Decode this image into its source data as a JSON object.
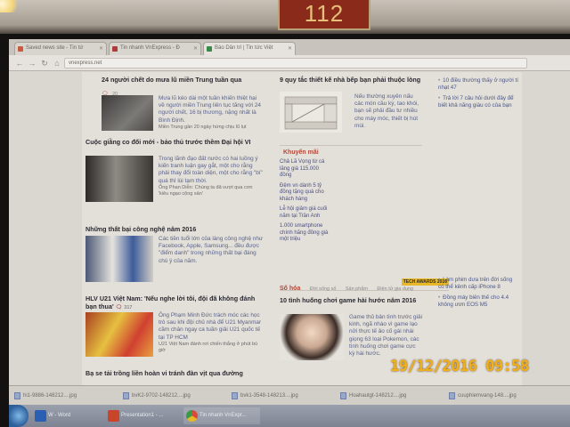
{
  "photo": {
    "wall_sign": "112",
    "timestamp": "19/12/2016 09:58"
  },
  "browser": {
    "tabs": [
      {
        "label": "Saved news site - Tin tứ",
        "active": false
      },
      {
        "label": "Tin nhanh VnExpress - Đ",
        "active": false
      },
      {
        "label": "Báo Dân trí | Tin tức Việt",
        "active": true
      }
    ],
    "url": "vnexpress.net"
  },
  "main_column": {
    "stories": [
      {
        "headline": "24 người chết do mưa lũ miền Trung tuần qua",
        "comments": "20",
        "summary": "Mưa lũ kéo dài một tuần khiến thiệt hại về người miền Trung liên tục tăng với 24 người chết, 16 bị thương, nặng nhất là Bình Định.",
        "related": "Miền Trung gần 20 ngày hứng chịu lũ lụt"
      },
      {
        "headline": "Cuộc giằng co đối mới - bảo thủ trước thềm Đại hội VI",
        "summary": "Trong lãnh đạo đất nước có hai luồng ý kiến tranh luận gay gắt, một cho rằng phải thay đổi toàn diện, một cho rằng \"bí\" quá thì lùi tạm thời.",
        "related": "Ông Phan Diễn: Chúng ta đã vượt qua cơn 'kiêu ngạo cộng sản'"
      },
      {
        "headline": "Những thất bại công nghệ năm 2016",
        "summary": "Các tiền tuổi lớn của làng công nghệ như Facebook, Apple, Samsung... đều được \"điểm danh\" trong những thất bại đáng chú ý của năm."
      },
      {
        "headline": "HLV U21 Việt Nam: 'Nếu nghe lời tôi, đội đã không đánh bạn thua'",
        "comments": "317",
        "summary": "Ông Phạm Minh Đức trách móc các học trò sau khi đội chủ nhà để U21 Myanmar cầm chân ngay ca tuần giải U21 quốc tế tại TP HCM",
        "related": "U21 Việt Nam đánh rơi chiến thắng ở phút bù giờ"
      },
      {
        "headline": "Bạ se tải trồng liền hoàn vi tránh đàn vịt qua đường"
      }
    ]
  },
  "middle_column": {
    "feature": {
      "headline": "9 quy tắc thiết kế nhà bếp bạn phải thuộc lòng",
      "summary": "Nếu thường xuyên nấu các món cầu kỳ, tao khói, bạn sẽ phải đầu tư nhiều cho máy móc, thiết bị hút mùi."
    },
    "promo": {
      "title": "Khuyến mãi",
      "items": [
        "Chả Lã Vọng từ cá lăng giá 115.000 đồng",
        "Đệm vn dành 5 tỷ đồng tặng quà cho khách hàng",
        "Lễ hội giảm giá cuối năm tại Trần Anh",
        "1.000 smartphone chính hãng đồng giá một triệu"
      ]
    },
    "section": {
      "name": "Số hóa",
      "links": [
        "Đời sống số",
        "Sản phẩm",
        "Điện tử gia dụng"
      ],
      "badge": "TECH AWARDS 2016"
    },
    "story": {
      "headline": "10 tình huống chơi game hài hước năm 2016",
      "summary": "Game thủ bản tình trước giải kinh, ngã nhào vì game lạo nửi thực tế ảo cố gái nhái giọng 63 loại Pokemon, các tình huống chơi game cực kỳ hài hước."
    }
  },
  "right_column": {
    "items": [
      "10 điều thường thấy ở người tí nhạt 47",
      "Trả lời 7 câu hỏi dưới đây để biết khả năng giàu có của bạn",
      "Làm phim dưa trên đời sống có thể kênh cấp iPhone 8",
      "Đồng máy biên thế cho 4.4 không ươn EOS M5"
    ]
  },
  "downloads": [
    "hi1-9886-148212....jpg",
    "bvK2-9702-148212....jpg",
    "bvk1-3548-148213....jpg",
    "Hoahautgt-148212....jpg",
    "cuuphiemvang-148....jpg"
  ],
  "taskbar": [
    {
      "label": "W - Word",
      "color": "#2b5fb4"
    },
    {
      "label": "Presentation1 - ...",
      "color": "#c8452a"
    },
    {
      "label": "Tin nhanh VnExpr...",
      "color": "#e0a020"
    }
  ]
}
